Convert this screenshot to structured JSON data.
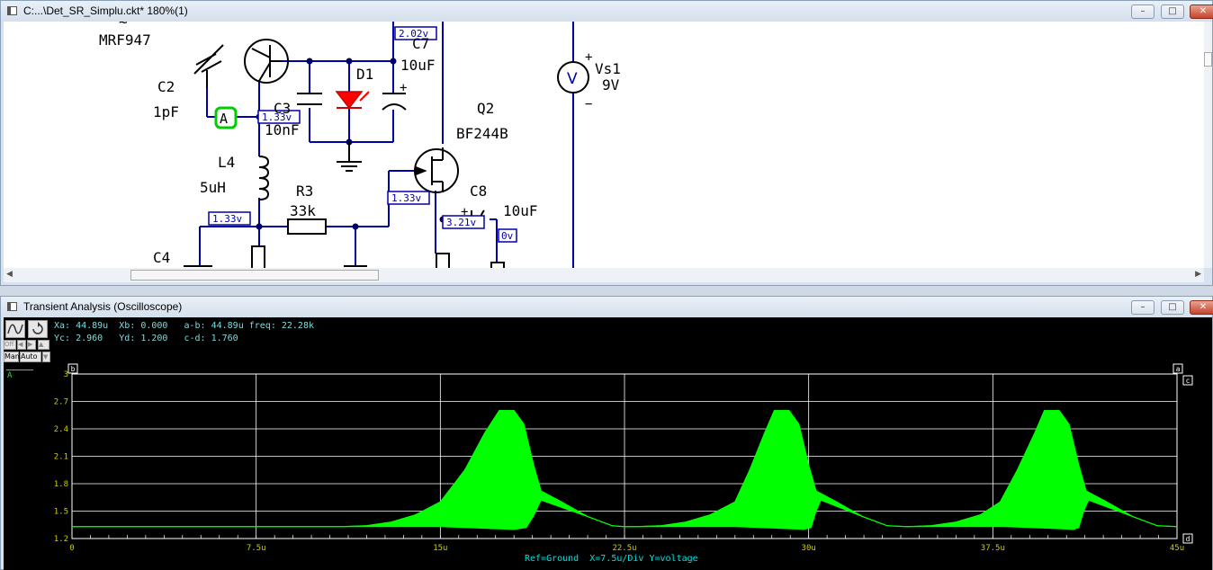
{
  "schematic_window": {
    "title": "C:...\\Det_SR_Simplu.ckt* 180%(1)",
    "labels": {
      "mrf": "MRF947",
      "c2": "C2",
      "c2v": "1pF",
      "probe": "A",
      "c3": "C3",
      "c3v": "10nF",
      "d1": "D1",
      "c7": "C7",
      "c7v": "10uF",
      "q2": "Q2",
      "q2m": "BF244B",
      "l4": "L4",
      "l4v": "5uH",
      "r3": "R3",
      "r3v": "33k",
      "c8": "C8",
      "c8v": "10uF",
      "c4": "C4",
      "vs1": "Vs1",
      "vs1v": "9V",
      "vsym": "V",
      "plus": "+",
      "minus": "−",
      "tilde": "~"
    },
    "tags": [
      "2.02v",
      "1.33v",
      "1.33v",
      "1.33v",
      "3.21v",
      "0v"
    ]
  },
  "scope_window": {
    "title": "Transient Analysis (Oscilloscope)",
    "readout_line1": "Xa: 44.89u  Xb: 0.000   a-b: 44.89u freq: 22.28k",
    "readout_line2": "Yc: 2.960   Yd: 1.200   c-d: 1.760",
    "man_label": "Man",
    "auto_label": "Auto",
    "off_label": "Off",
    "trace_label": "A",
    "cursors": {
      "a": "a",
      "b": "b",
      "c": "c",
      "d": "d"
    },
    "footer": "Ref=Ground  X=7.5u/Div Y=voltage"
  },
  "window_buttons": {
    "min": "–",
    "max": "□",
    "close": "✕"
  },
  "colors": {
    "trace": "#00ff00",
    "grid": "#ffffff",
    "wire": "#0000aa",
    "tag": "#0000aa",
    "probe": "#00cc00",
    "led": "#ff0000",
    "tick_text": "#cccc00",
    "footer": "#00e0e0"
  },
  "chart_data": {
    "type": "line",
    "title": "",
    "xlabel": "",
    "ylabel": "",
    "x_ticks": [
      "0",
      "7.5u",
      "15u",
      "22.5u",
      "30u",
      "37.5u",
      "45u"
    ],
    "y_ticks": [
      "1.2",
      "1.5",
      "1.8",
      "2.1",
      "2.4",
      "2.7",
      "3"
    ],
    "xlim": [
      0,
      45
    ],
    "ylim": [
      1.2,
      3.0
    ],
    "series": [
      {
        "name": "A",
        "upper_envelope": [
          [
            0,
            1.33
          ],
          [
            11,
            1.33
          ],
          [
            12,
            1.34
          ],
          [
            13,
            1.38
          ],
          [
            14,
            1.46
          ],
          [
            15,
            1.6
          ],
          [
            16,
            1.95
          ],
          [
            16.8,
            2.35
          ],
          [
            17.4,
            2.6
          ],
          [
            18,
            2.6
          ],
          [
            18.4,
            2.45
          ],
          [
            18.8,
            2.0
          ],
          [
            19.1,
            1.72
          ],
          [
            19.8,
            1.62
          ],
          [
            21,
            1.44
          ],
          [
            22,
            1.34
          ],
          [
            22.5,
            1.33
          ],
          [
            22.5,
            1.33
          ],
          [
            23,
            1.33
          ],
          [
            24,
            1.34
          ],
          [
            25,
            1.38
          ],
          [
            26,
            1.46
          ],
          [
            27,
            1.6
          ],
          [
            27.6,
            1.95
          ],
          [
            28.2,
            2.35
          ],
          [
            28.6,
            2.6
          ],
          [
            29.2,
            2.6
          ],
          [
            29.6,
            2.45
          ],
          [
            30,
            2.0
          ],
          [
            30.3,
            1.72
          ],
          [
            31,
            1.62
          ],
          [
            32.2,
            1.44
          ],
          [
            33.2,
            1.34
          ],
          [
            34,
            1.33
          ],
          [
            34,
            1.33
          ],
          [
            35,
            1.34
          ],
          [
            36,
            1.38
          ],
          [
            37,
            1.46
          ],
          [
            37.8,
            1.6
          ],
          [
            38.5,
            1.95
          ],
          [
            39.2,
            2.35
          ],
          [
            39.6,
            2.6
          ],
          [
            40.2,
            2.6
          ],
          [
            40.6,
            2.45
          ],
          [
            41,
            2.0
          ],
          [
            41.3,
            1.72
          ],
          [
            42,
            1.62
          ],
          [
            43.2,
            1.44
          ],
          [
            44.2,
            1.34
          ],
          [
            45,
            1.33
          ]
        ],
        "lower_envelope": [
          [
            0,
            1.33
          ],
          [
            15,
            1.33
          ],
          [
            16,
            1.32
          ],
          [
            17,
            1.31
          ],
          [
            18,
            1.3
          ],
          [
            18.5,
            1.32
          ],
          [
            18.8,
            1.45
          ],
          [
            19.1,
            1.62
          ],
          [
            21,
            1.44
          ],
          [
            22,
            1.34
          ],
          [
            22.5,
            1.33
          ],
          [
            27,
            1.33
          ],
          [
            28,
            1.32
          ],
          [
            29,
            1.31
          ],
          [
            29.8,
            1.3
          ],
          [
            30.1,
            1.32
          ],
          [
            30.3,
            1.5
          ],
          [
            30.5,
            1.62
          ],
          [
            32.2,
            1.44
          ],
          [
            33.2,
            1.34
          ],
          [
            34,
            1.33
          ],
          [
            38,
            1.33
          ],
          [
            39,
            1.32
          ],
          [
            40,
            1.31
          ],
          [
            40.8,
            1.3
          ],
          [
            41,
            1.32
          ],
          [
            41.2,
            1.5
          ],
          [
            41.4,
            1.62
          ],
          [
            43.2,
            1.44
          ],
          [
            44.2,
            1.34
          ],
          [
            45,
            1.33
          ]
        ]
      }
    ],
    "grid": true,
    "legend": "top-left"
  }
}
